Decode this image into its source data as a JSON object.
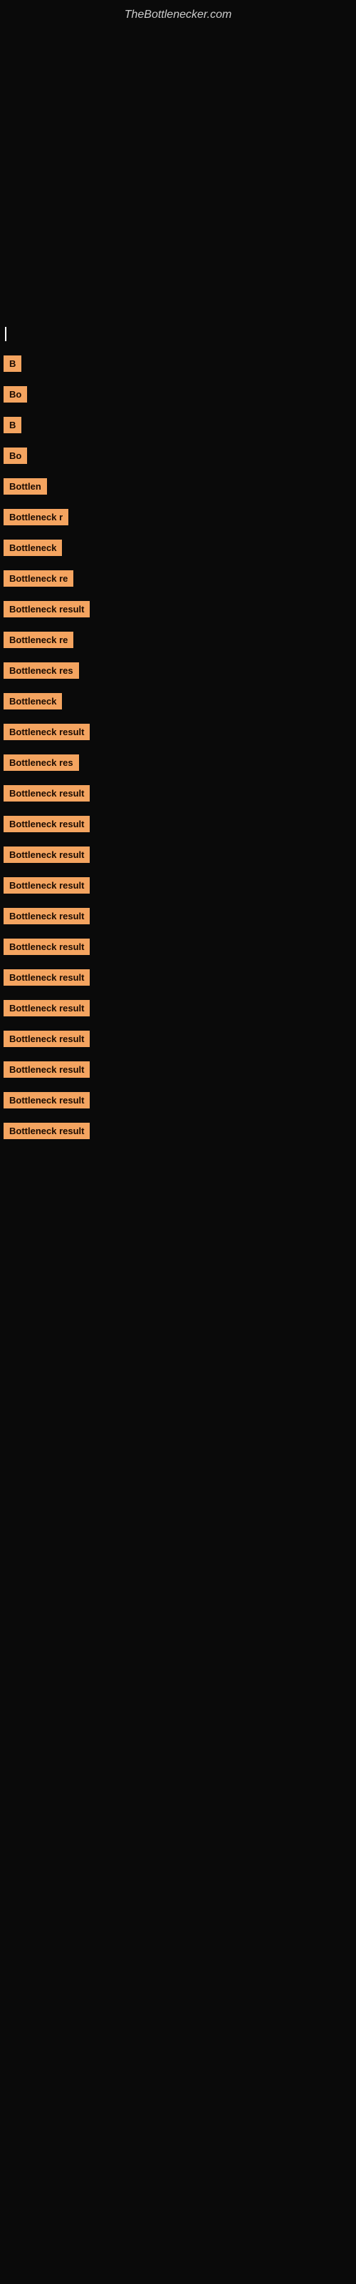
{
  "site": {
    "title": "TheBottlenecker.com"
  },
  "items": [
    {
      "id": 1,
      "label": "|",
      "width": 6,
      "is_cursor": true
    },
    {
      "id": 2,
      "label": "B",
      "width": 16,
      "is_cursor": false
    },
    {
      "id": 3,
      "label": "Bo",
      "width": 22,
      "is_cursor": false
    },
    {
      "id": 4,
      "label": "B",
      "width": 16,
      "is_cursor": false
    },
    {
      "id": 5,
      "label": "Bo",
      "width": 22,
      "is_cursor": false
    },
    {
      "id": 6,
      "label": "Bottlen",
      "width": 56,
      "is_cursor": false
    },
    {
      "id": 7,
      "label": "Bottleneck r",
      "width": 90,
      "is_cursor": false
    },
    {
      "id": 8,
      "label": "Bottleneck",
      "width": 78,
      "is_cursor": false
    },
    {
      "id": 9,
      "label": "Bottleneck re",
      "width": 98,
      "is_cursor": false
    },
    {
      "id": 10,
      "label": "Bottleneck result",
      "width": 130,
      "is_cursor": false
    },
    {
      "id": 11,
      "label": "Bottleneck re",
      "width": 100,
      "is_cursor": false
    },
    {
      "id": 12,
      "label": "Bottleneck res",
      "width": 108,
      "is_cursor": false
    },
    {
      "id": 13,
      "label": "Bottleneck",
      "width": 78,
      "is_cursor": false
    },
    {
      "id": 14,
      "label": "Bottleneck result",
      "width": 130,
      "is_cursor": false
    },
    {
      "id": 15,
      "label": "Bottleneck res",
      "width": 108,
      "is_cursor": false
    },
    {
      "id": 16,
      "label": "Bottleneck result",
      "width": 130,
      "is_cursor": false
    },
    {
      "id": 17,
      "label": "Bottleneck result",
      "width": 130,
      "is_cursor": false
    },
    {
      "id": 18,
      "label": "Bottleneck result",
      "width": 130,
      "is_cursor": false
    },
    {
      "id": 19,
      "label": "Bottleneck result",
      "width": 130,
      "is_cursor": false
    },
    {
      "id": 20,
      "label": "Bottleneck result",
      "width": 130,
      "is_cursor": false
    },
    {
      "id": 21,
      "label": "Bottleneck result",
      "width": 130,
      "is_cursor": false
    },
    {
      "id": 22,
      "label": "Bottleneck result",
      "width": 130,
      "is_cursor": false
    },
    {
      "id": 23,
      "label": "Bottleneck result",
      "width": 130,
      "is_cursor": false
    },
    {
      "id": 24,
      "label": "Bottleneck result",
      "width": 130,
      "is_cursor": false
    },
    {
      "id": 25,
      "label": "Bottleneck result",
      "width": 130,
      "is_cursor": false
    },
    {
      "id": 26,
      "label": "Bottleneck result",
      "width": 130,
      "is_cursor": false
    },
    {
      "id": 27,
      "label": "Bottleneck result",
      "width": 130,
      "is_cursor": false
    }
  ]
}
